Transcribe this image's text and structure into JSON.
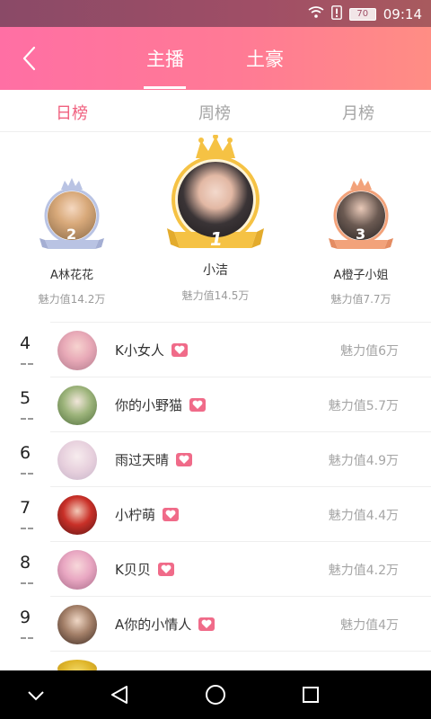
{
  "status_bar": {
    "time": "09:14",
    "battery": "70",
    "icons": [
      "wifi-icon",
      "alert-icon",
      "battery-icon"
    ]
  },
  "header": {
    "back_icon": "back-arrow-icon",
    "tabs": [
      {
        "label": "主播",
        "active": true
      },
      {
        "label": "土豪",
        "active": false
      }
    ]
  },
  "sub_tabs": [
    {
      "label": "日榜",
      "active": true
    },
    {
      "label": "周榜",
      "active": false
    },
    {
      "label": "月榜",
      "active": false
    }
  ],
  "podium": [
    {
      "rank": "1",
      "name": "小洁",
      "charm": "魅力值14.5万",
      "frame": "gold"
    },
    {
      "rank": "2",
      "name": "A林花花",
      "charm": "魅力值14.2万",
      "frame": "silver"
    },
    {
      "rank": "3",
      "name": "A橙子小姐",
      "charm": "魅力值7.7万",
      "frame": "bronze"
    }
  ],
  "list": [
    {
      "rank": "4",
      "name": "K小女人",
      "charm": "魅力值6万"
    },
    {
      "rank": "5",
      "name": "你的小野猫",
      "charm": "魅力值5.7万"
    },
    {
      "rank": "6",
      "name": "雨过天晴",
      "charm": "魅力值4.9万"
    },
    {
      "rank": "7",
      "name": "小柠萌",
      "charm": "魅力值4.4万"
    },
    {
      "rank": "8",
      "name": "K贝贝",
      "charm": "魅力值4.2万"
    },
    {
      "rank": "9",
      "name": "A你的小情人",
      "charm": "魅力值4万"
    }
  ],
  "colors": {
    "accent": "#f0617f",
    "header_start": "#ff6fa4",
    "header_end": "#ff8d84",
    "gold": "#f5c244",
    "silver": "#b9c3e3",
    "bronze": "#f2a27a"
  },
  "nav": [
    "chevron-down-icon",
    "back-triangle-icon",
    "home-circle-icon",
    "recent-square-icon"
  ]
}
